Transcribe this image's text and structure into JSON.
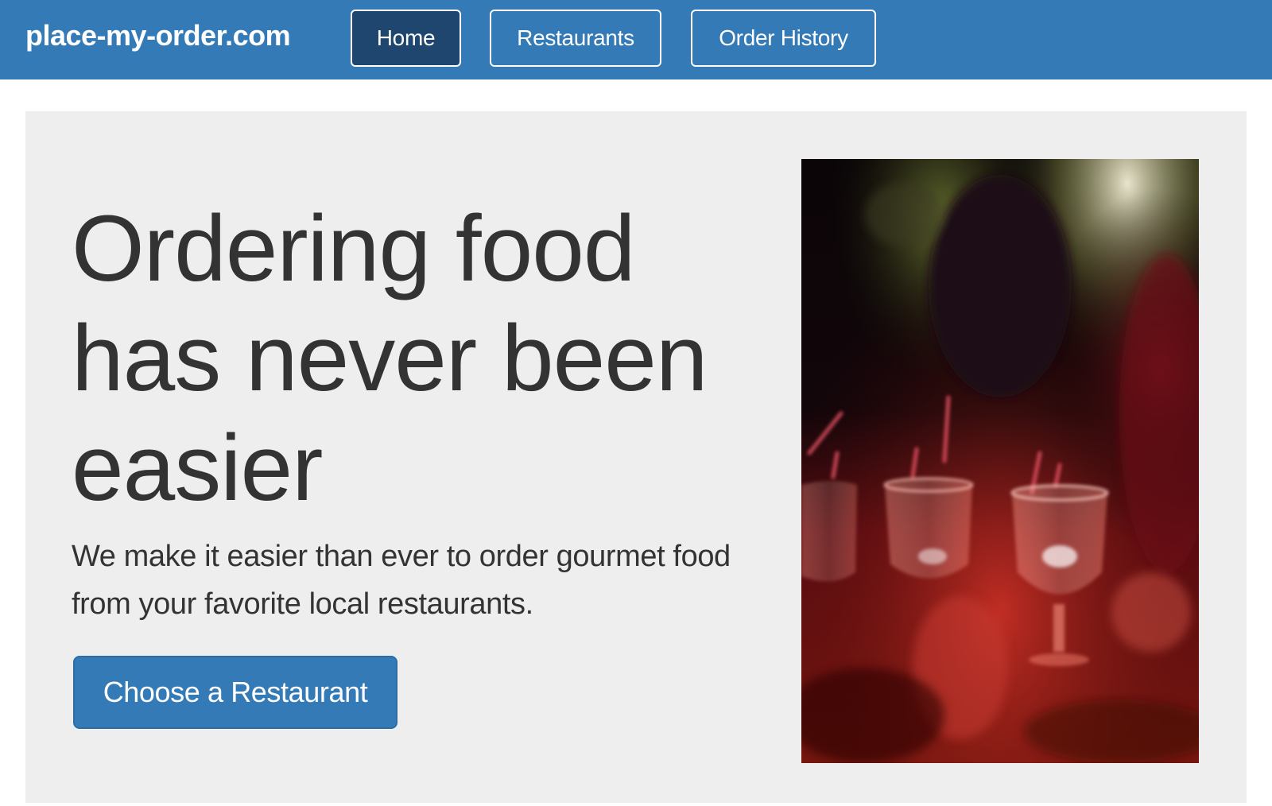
{
  "site": {
    "brand": "place-my-order.com"
  },
  "nav": {
    "items": [
      {
        "label": "Home",
        "active": true
      },
      {
        "label": "Restaurants",
        "active": false
      },
      {
        "label": "Order History",
        "active": false
      }
    ]
  },
  "hero": {
    "headline": "Ordering food has never been easier",
    "lead": "We make it easier than ever to order gourmet food from your favorite local restaurants.",
    "cta_label": "Choose a Restaurant",
    "image_subject": "dim restaurant table with wine glasses under red light"
  },
  "colors": {
    "navbar": "#337ab7",
    "nav_active": "#1e466e",
    "jumbotron_bg": "#eeeeee",
    "text": "#333333",
    "button": "#337ab7"
  }
}
